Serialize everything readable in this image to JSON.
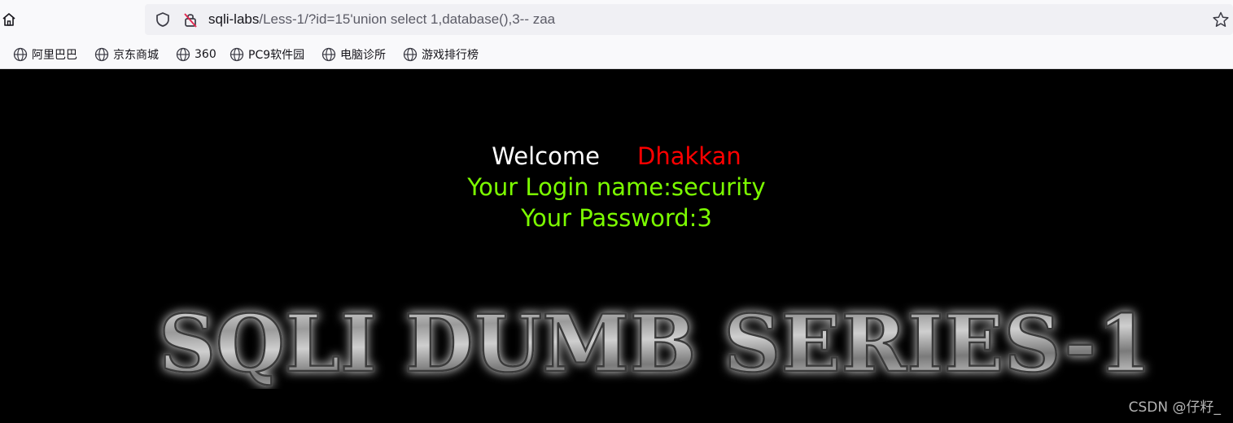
{
  "browser": {
    "url_host": "sqli-labs",
    "url_rest": "/Less-1/?id=15'union select 1,database(),3-- zaa",
    "icons": [
      "home-icon",
      "shield-icon",
      "lock-crossed-icon",
      "star-icon",
      "globe-icon"
    ]
  },
  "bookmarks": [
    {
      "label": "阿里巴巴"
    },
    {
      "label": "京东商城"
    },
    {
      "label": "360"
    },
    {
      "label": "PC9软件园"
    },
    {
      "label": "电脑诊所"
    },
    {
      "label": "游戏排行榜"
    }
  ],
  "page": {
    "welcome": "Welcome",
    "user": "Dhakkan",
    "login_line": "Your Login name:security",
    "password_line": "Your Password:3",
    "banner_text": "SQLI DUMB SERIES-1",
    "colors": {
      "background": "#000000",
      "welcome": "#ffffff",
      "user": "#ff0000",
      "result": "#7cfc00"
    }
  },
  "watermark": "CSDN @仔籽_"
}
